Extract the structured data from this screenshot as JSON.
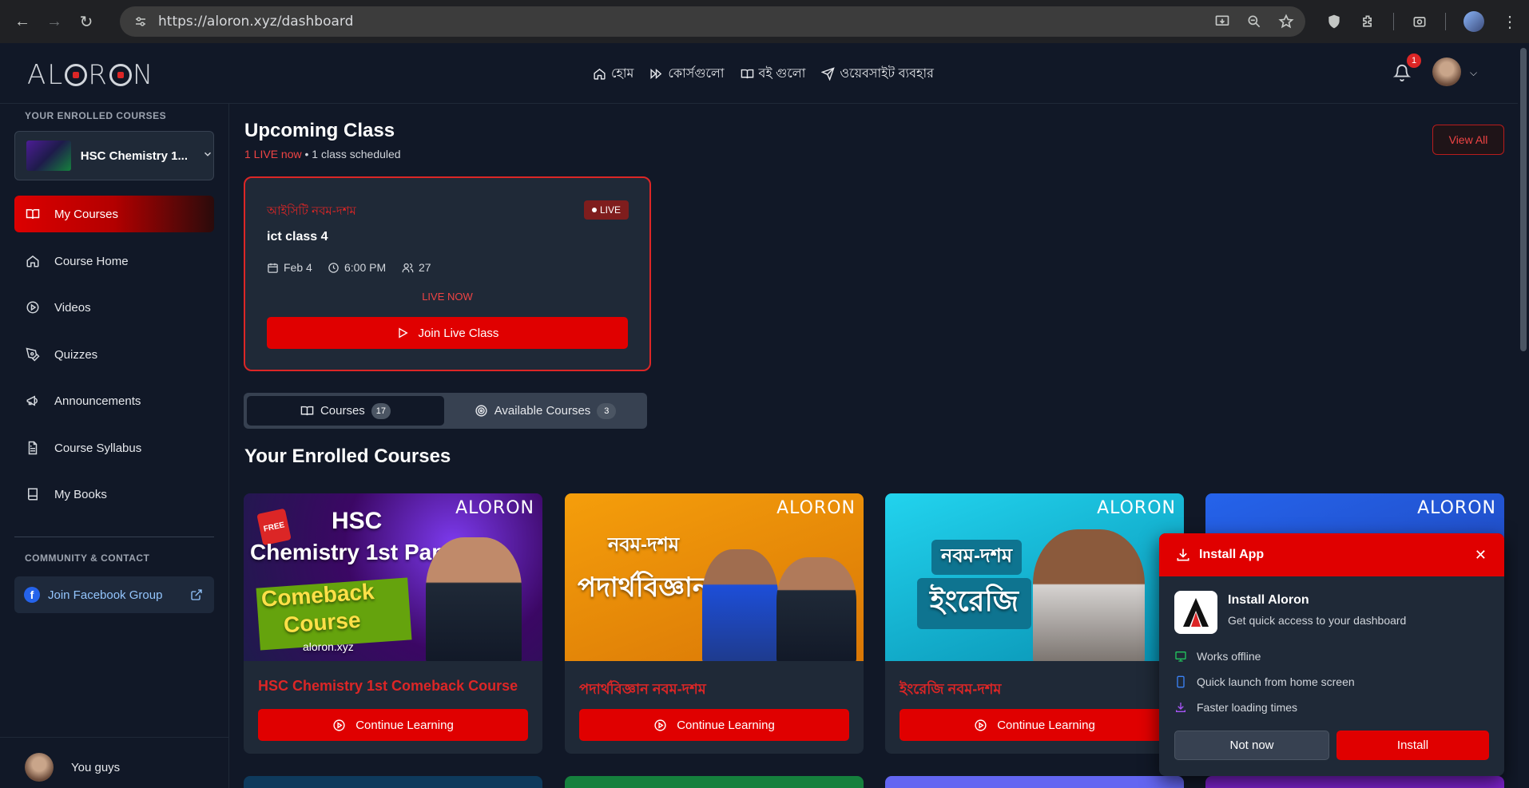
{
  "browser": {
    "url": "https://aloron.xyz/dashboard"
  },
  "header": {
    "logo": "ALORON",
    "nav": [
      {
        "label": "হোম",
        "icon": "home-icon"
      },
      {
        "label": "কোর্সগুলো",
        "icon": "fast-forward-icon"
      },
      {
        "label": "বই গুলো",
        "icon": "book-open-icon"
      },
      {
        "label": "ওয়েবসাইট ব্যবহার",
        "icon": "send-icon"
      }
    ],
    "notification_count": "1"
  },
  "sidebar": {
    "enrolled_label": "YOUR ENROLLED COURSES",
    "selected_course": "HSC Chemistry 1...",
    "items": [
      {
        "label": "My Courses",
        "icon": "book-open-icon",
        "active": true
      },
      {
        "label": "Course Home",
        "icon": "home-icon"
      },
      {
        "label": "Videos",
        "icon": "play-circle-icon"
      },
      {
        "label": "Quizzes",
        "icon": "pen-icon"
      },
      {
        "label": "Announcements",
        "icon": "megaphone-icon"
      },
      {
        "label": "Course Syllabus",
        "icon": "file-text-icon"
      },
      {
        "label": "My Books",
        "icon": "book-icon"
      }
    ],
    "community_label": "COMMUNITY & CONTACT",
    "facebook_label": "Join Facebook Group",
    "user_name": "You guys"
  },
  "upcoming": {
    "title": "Upcoming Class",
    "live_text": "1 LIVE now",
    "separator": " • ",
    "scheduled_text": "1 class scheduled",
    "view_all": "View All",
    "card": {
      "subject": "আইসিটি নবম-দশম",
      "badge": "LIVE",
      "name": "ict class 4",
      "date": "Feb 4",
      "time": "6:00 PM",
      "attendees": "27",
      "status": "LIVE NOW",
      "join_label": "Join Live Class"
    }
  },
  "tabs": [
    {
      "label": "Courses",
      "count": "17",
      "active": true
    },
    {
      "label": "Available Courses",
      "count": "3",
      "active": false
    }
  ],
  "enrolled": {
    "title": "Your Enrolled Courses",
    "courses": [
      {
        "title": "HSC Chemistry 1st Comeback Course",
        "button": "Continue Learning",
        "thumb_lines": [
          "HSC",
          "Chemistry 1st Paper",
          "Comeback",
          "Course",
          "aloron.xyz"
        ],
        "thumb_badge": "FREE"
      },
      {
        "title": "পদার্থবিজ্ঞান নবম-দশম",
        "button": "Continue Learning",
        "thumb_lines": [
          "নবম-দশম",
          "পদার্থবিজ্ঞান"
        ]
      },
      {
        "title": "ইংরেজি নবম-দশম",
        "button": "Continue Learning",
        "thumb_lines": [
          "নবম-দশম",
          "ইংরেজি"
        ]
      }
    ],
    "brand": "ALORON"
  },
  "install_popup": {
    "header": "Install App",
    "app_name": "Install Aloron",
    "app_desc": "Get quick access to your dashboard",
    "features": [
      "Works offline",
      "Quick launch from home screen",
      "Faster loading times"
    ],
    "not_now": "Not now",
    "install": "Install"
  },
  "colors": {
    "accent": "#e00000",
    "background": "#111827",
    "card": "#1f2937"
  }
}
